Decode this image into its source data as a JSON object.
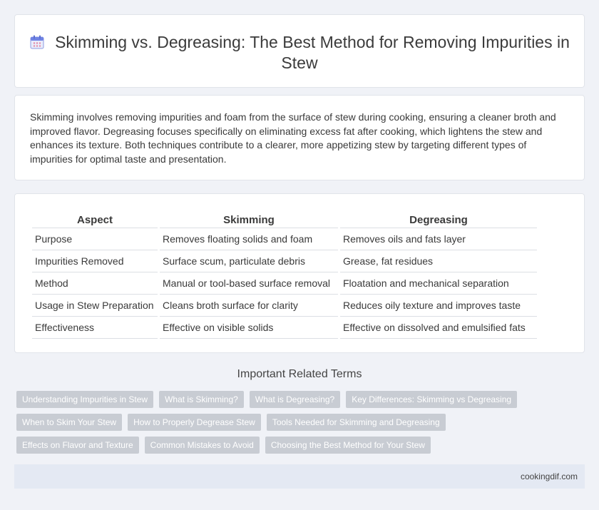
{
  "header": {
    "title": "Skimming vs. Degreasing: The Best Method for Removing Impurities in Stew",
    "icon": "calendar-icon"
  },
  "intro": {
    "text": "Skimming involves removing impurities and foam from the surface of stew during cooking, ensuring a cleaner broth and improved flavor. Degreasing focuses specifically on eliminating excess fat after cooking, which lightens the stew and enhances its texture. Both techniques contribute to a clearer, more appetizing stew by targeting different types of impurities for optimal taste and presentation."
  },
  "table": {
    "headers": [
      "Aspect",
      "Skimming",
      "Degreasing"
    ],
    "rows": [
      [
        "Purpose",
        "Removes floating solids and foam",
        "Removes oils and fats layer"
      ],
      [
        "Impurities Removed",
        "Surface scum, particulate debris",
        "Grease, fat residues"
      ],
      [
        "Method",
        "Manual or tool-based surface removal",
        "Floatation and mechanical separation"
      ],
      [
        "Usage in Stew Preparation",
        "Cleans broth surface for clarity",
        "Reduces oily texture and improves taste"
      ],
      [
        "Effectiveness",
        "Effective on visible solids",
        "Effective on dissolved and emulsified fats"
      ]
    ]
  },
  "related": {
    "title": "Important Related Terms",
    "tags": [
      "Understanding Impurities in Stew",
      "What is Skimming?",
      "What is Degreasing?",
      "Key Differences: Skimming vs Degreasing",
      "When to Skim Your Stew",
      "How to Properly Degrease Stew",
      "Tools Needed for Skimming and Degreasing",
      "Effects on Flavor and Texture",
      "Common Mistakes to Avoid",
      "Choosing the Best Method for Your Stew"
    ]
  },
  "footer": {
    "site": "cookingdif.com"
  },
  "colors": {
    "background": "#f0f2f7",
    "tag": "#c8ccd3",
    "footer": "#e4e9f3"
  }
}
